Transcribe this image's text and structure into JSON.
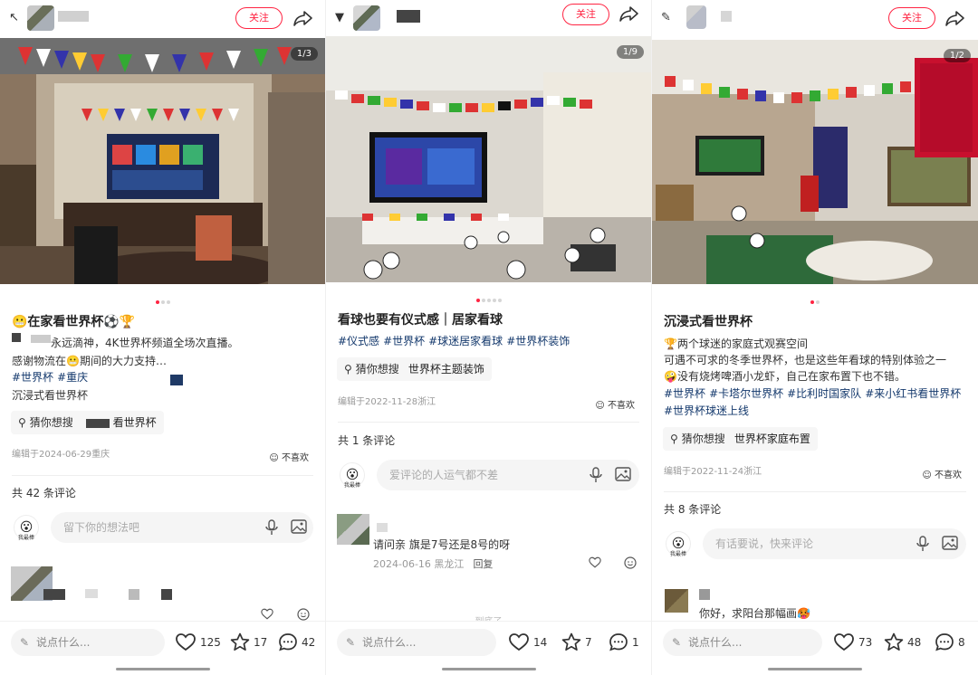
{
  "colors": {
    "accent": "#ff2442",
    "tag": "#13386c",
    "muted": "#999999"
  },
  "panels": [
    {
      "follow": "关注",
      "counter": "1/3",
      "title": "😬在家看世界杯⚽🏆",
      "body_lines": [
        "永远滴神，4K世界杯频道全场次直播。",
        "感谢物流在😬期间的大力支持…"
      ],
      "tags": [
        "#世界杯",
        "#重庆"
      ],
      "extra_line": "沉浸式看世界杯",
      "guess_label": "猜你想搜",
      "guess_term": "看世界杯",
      "meta": "编辑于2024-06-29重庆",
      "dislike": "不喜欢",
      "comment_count": "共 42 条评论",
      "comment_placeholder": "留下你的想法吧",
      "say": "说点什么...",
      "likes": "125",
      "stars": "17",
      "comments": "42"
    },
    {
      "follow": "关注",
      "counter": "1/9",
      "title": "看球也要有仪式感｜居家看球",
      "tags": [
        "#仪式感",
        "#世界杯",
        "#球迷居家看球",
        "#世界杯装饰"
      ],
      "guess_label": "猜你想搜",
      "guess_term": "世界杯主题装饰",
      "meta": "编辑于2022-11-28浙江",
      "dislike": "不喜欢",
      "comment_count": "共 1 条评论",
      "comment_placeholder": "爱评论的人运气都不差",
      "reply_text": "请问亲 旗是7号还是8号的呀",
      "reply_meta": "2024-06-16 黑龙江",
      "reply_btn": "回复",
      "end_hint": "到底了",
      "say": "说点什么...",
      "likes": "14",
      "stars": "7",
      "comments": "1"
    },
    {
      "follow": "关注",
      "counter": "1/2",
      "title": "沉浸式看世界杯",
      "body_lines": [
        "🏆两个球迷的家庭式观赛空间",
        "可遇不可求的冬季世界杯，也是这些年看球的特别体验之一",
        "🤪没有烧烤啤酒小龙虾，自己在家布置下也不错。"
      ],
      "tags": [
        "#世界杯",
        "#卡塔尔世界杯",
        "#比利时国家队",
        "#来小红书看世界杯",
        "#世界杯球迷上线"
      ],
      "guess_label": "猜你想搜",
      "guess_term": "世界杯家庭布置",
      "meta": "编辑于2022-11-24浙江",
      "dislike": "不喜欢",
      "comment_count": "共 8 条评论",
      "comment_placeholder": "有话要说，快来评论",
      "reply_text": "你好，求阳台那幅画🥵",
      "say": "说点什么...",
      "likes": "73",
      "stars": "48",
      "comments": "8"
    }
  ]
}
